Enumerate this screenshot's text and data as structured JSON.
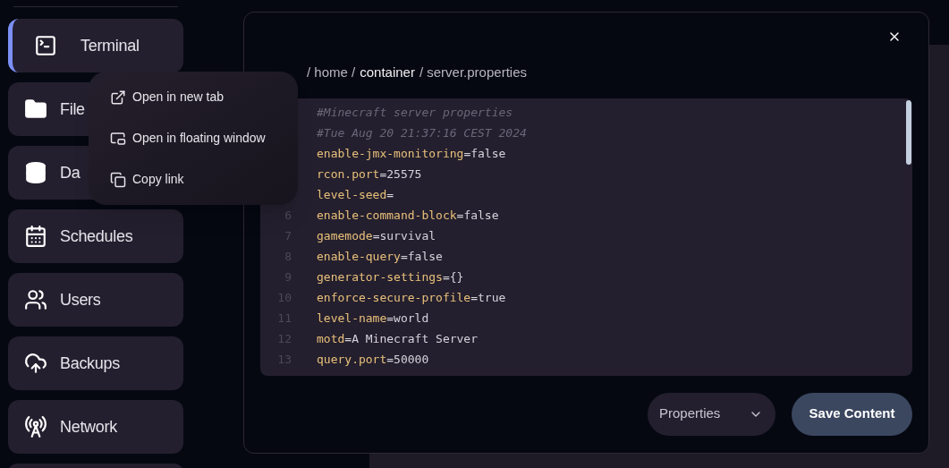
{
  "sidebar": {
    "items": [
      {
        "label": "Terminal",
        "selected": true
      },
      {
        "label": "File",
        "selected": false
      },
      {
        "label": "Da",
        "selected": false
      },
      {
        "label": "Schedules",
        "selected": false
      },
      {
        "label": "Users",
        "selected": false
      },
      {
        "label": "Backups",
        "selected": false
      },
      {
        "label": "Network",
        "selected": false
      }
    ]
  },
  "context_menu": {
    "items": [
      {
        "label": "Open in new tab"
      },
      {
        "label": "Open in floating window"
      },
      {
        "label": "Copy link"
      }
    ]
  },
  "dialog": {
    "breadcrumb": [
      {
        "label": "/ home /",
        "current": false
      },
      {
        "label": "container",
        "current": true
      },
      {
        "label": "/ server.properties",
        "current": false
      }
    ],
    "editor": {
      "lines": [
        {
          "kind": "comment",
          "text": "#Minecraft server properties"
        },
        {
          "kind": "comment",
          "text": "#Tue Aug 20 21:37:16 CEST 2024"
        },
        {
          "kind": "pair",
          "key": "enable-jmx-monitoring",
          "sep": "=",
          "value": "false"
        },
        {
          "kind": "pair",
          "key": "rcon.port",
          "sep": "=",
          "value": "25575"
        },
        {
          "kind": "pair",
          "key": "level-seed",
          "sep": "="
        },
        {
          "kind": "pair",
          "number": "6",
          "key": "enable-command-block",
          "sep": "=",
          "value": "false"
        },
        {
          "kind": "pair",
          "number": "7",
          "key": "gamemode",
          "sep": "=",
          "value": "survival"
        },
        {
          "kind": "pair",
          "number": "8",
          "key": "enable-query",
          "sep": "=",
          "value": "false"
        },
        {
          "kind": "pair",
          "number": "9",
          "key": "generator-settings",
          "sep": "=",
          "value": "{}"
        },
        {
          "kind": "pair",
          "number": "10",
          "key": "enforce-secure-profile",
          "sep": "=",
          "value": "true"
        },
        {
          "kind": "pair",
          "number": "11",
          "key": "level-name",
          "sep": "=",
          "value": "world"
        },
        {
          "kind": "pair",
          "number": "12",
          "key": "motd",
          "sep": "=",
          "value": "A Minecraft Server"
        },
        {
          "kind": "pair",
          "number": "13",
          "key": "query.port",
          "sep": "=",
          "value": "50000"
        }
      ]
    },
    "language_select": {
      "value": "Properties"
    },
    "save_button": {
      "label": "Save Content"
    }
  }
}
